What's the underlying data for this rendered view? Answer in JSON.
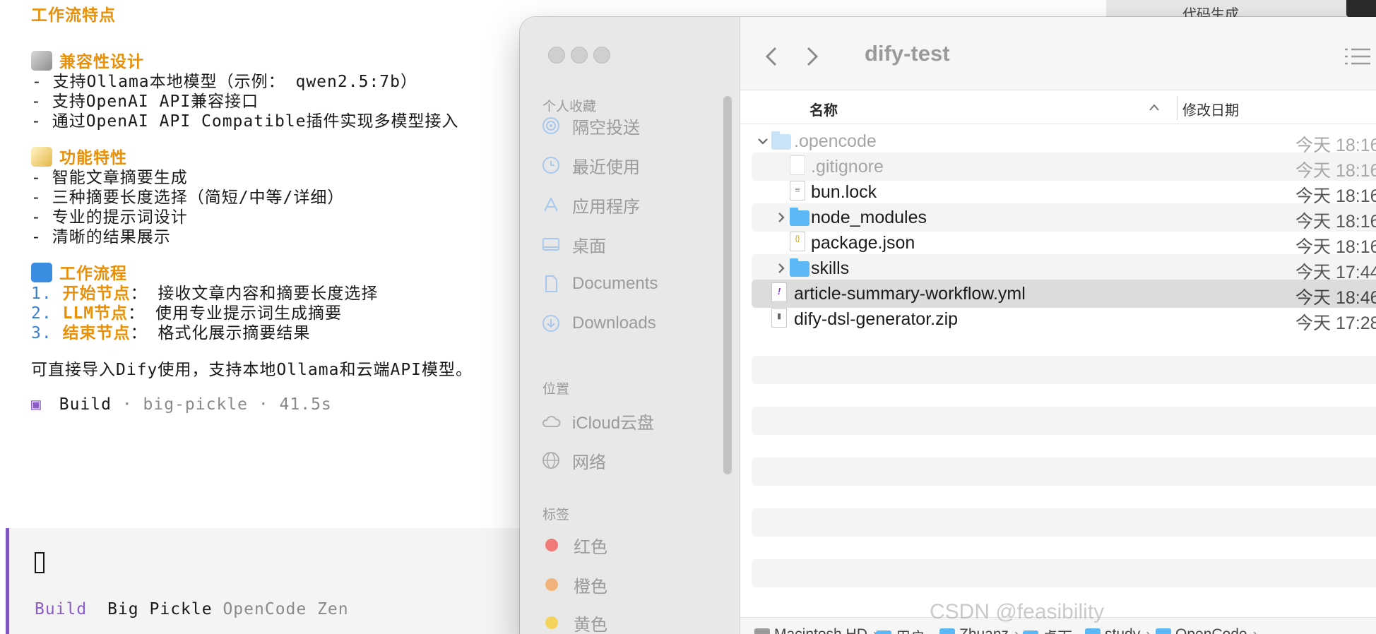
{
  "terminal": {
    "heading": "工作流特点",
    "compat": {
      "title": "兼容性设计",
      "items": [
        "- 支持Ollama本地模型（示例： qwen2.5:7b）",
        "- 支持OpenAI API兼容接口",
        "- 通过OpenAI API Compatible插件实现多模型接入"
      ]
    },
    "features": {
      "title": "功能特性",
      "items": [
        "- 智能文章摘要生成",
        "- 三种摘要长度选择（简短/中等/详细）",
        "- 专业的提示词设计",
        "- 清晰的结果展示"
      ]
    },
    "flow": {
      "title": "工作流程",
      "steps": [
        {
          "num": "1.",
          "label": "开始节点",
          "text": "： 接收文章内容和摘要长度选择"
        },
        {
          "num": "2.",
          "label": "LLM节点",
          "text": "： 使用专业提示词生成摘要"
        },
        {
          "num": "3.",
          "label": "结束节点",
          "text": "： 格式化展示摘要结果"
        }
      ]
    },
    "summary": "可直接导入Dify使用，支持本地Ollama和云端API模型。",
    "build_status": {
      "icon": "▣",
      "mode": "Build",
      "model": "· big-pickle · 41.5s"
    },
    "prompt_footer": {
      "mode": "Build",
      "model": "Big Pickle",
      "provider": "OpenCode Zen"
    },
    "top_right_text": "代码生成"
  },
  "finder": {
    "title": "dify-test",
    "sidebar": {
      "favorites_title": "个人收藏",
      "favorites": [
        "隔空投送",
        "最近使用",
        "应用程序",
        "桌面",
        "Documents",
        "Downloads"
      ],
      "locations_title": "位置",
      "locations": [
        "iCloud云盘",
        "网络"
      ],
      "tags_title": "标签",
      "tags": [
        {
          "label": "红色",
          "color": "#f07a78"
        },
        {
          "label": "橙色",
          "color": "#f2b37a"
        },
        {
          "label": "黄色",
          "color": "#f3d35c"
        }
      ]
    },
    "columns": {
      "name": "名称",
      "date": "修改日期"
    },
    "files": [
      {
        "name": ".opencode",
        "date": "今天 18:16",
        "kind": "folder",
        "disclosure": "⌄"
      },
      {
        "name": ".gitignore",
        "date": "今天 18:16",
        "kind": "doc",
        "glyph": ""
      },
      {
        "name": "bun.lock",
        "date": "今天 18:16",
        "kind": "doc",
        "glyph": "≡"
      },
      {
        "name": "node_modules",
        "date": "今天 18:16",
        "kind": "folder",
        "disclosure": "›"
      },
      {
        "name": "package.json",
        "date": "今天 18:16",
        "kind": "doc",
        "glyph": "{}"
      },
      {
        "name": "skills",
        "date": "今天 17:44",
        "kind": "folder",
        "disclosure": "›"
      },
      {
        "name": "article-summary-workflow.yml",
        "date": "今天 18:46",
        "kind": "doc",
        "glyph": "!"
      },
      {
        "name": "dify-dsl-generator.zip",
        "date": "今天 17:28",
        "kind": "doc",
        "glyph": "▮"
      }
    ],
    "path": [
      "Macintosh HD",
      "用户",
      "Zhuanz",
      "桌面",
      "study",
      "OpenCode"
    ]
  },
  "watermark": "CSDN @feasibility"
}
